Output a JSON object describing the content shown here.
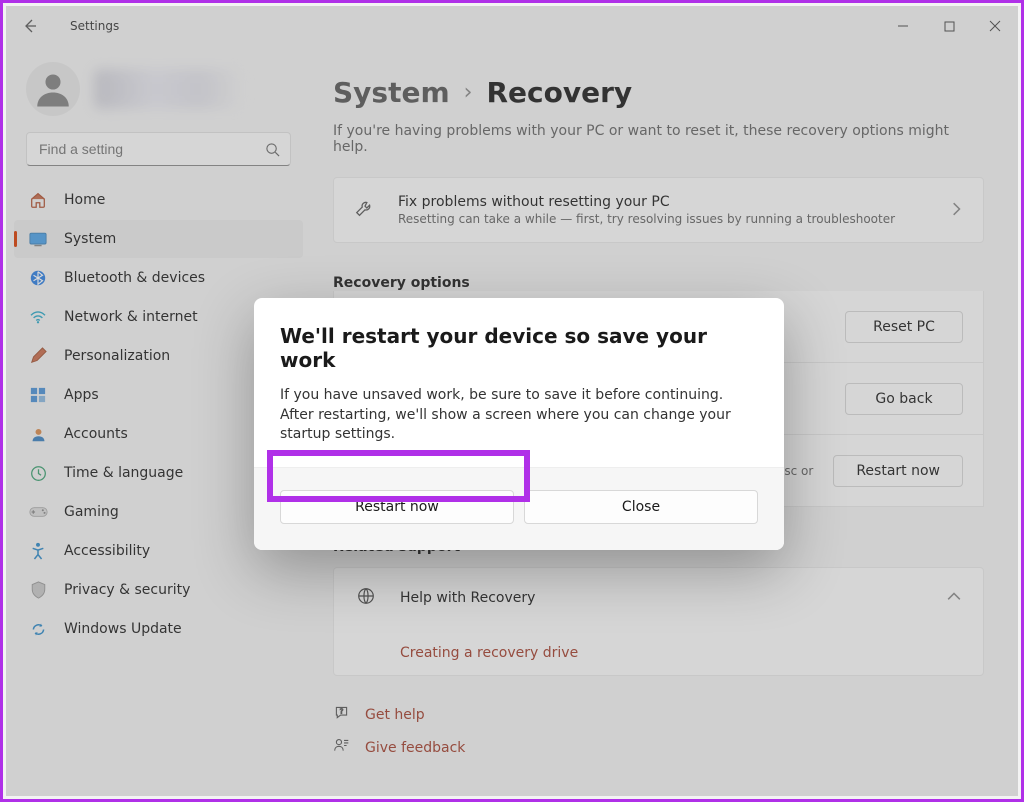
{
  "window": {
    "title": "Settings"
  },
  "search": {
    "placeholder": "Find a setting"
  },
  "nav": {
    "items": [
      {
        "label": "Home",
        "icon": "home-icon"
      },
      {
        "label": "System",
        "icon": "system-icon"
      },
      {
        "label": "Bluetooth & devices",
        "icon": "bluetooth-icon"
      },
      {
        "label": "Network & internet",
        "icon": "network-icon"
      },
      {
        "label": "Personalization",
        "icon": "personalization-icon"
      },
      {
        "label": "Apps",
        "icon": "apps-icon"
      },
      {
        "label": "Accounts",
        "icon": "accounts-icon"
      },
      {
        "label": "Time & language",
        "icon": "time-language-icon"
      },
      {
        "label": "Gaming",
        "icon": "gaming-icon"
      },
      {
        "label": "Accessibility",
        "icon": "accessibility-icon"
      },
      {
        "label": "Privacy & security",
        "icon": "privacy-icon"
      },
      {
        "label": "Windows Update",
        "icon": "update-icon"
      }
    ],
    "active_index": 1
  },
  "breadcrumb": {
    "parent": "System",
    "current": "Recovery"
  },
  "intro": "If you're having problems with your PC or want to reset it, these recovery options might help.",
  "fix_card": {
    "title": "Fix problems without resetting your PC",
    "subtitle": "Resetting can take a while — first, try resolving issues by running a troubleshooter"
  },
  "recovery": {
    "section_title": "Recovery options",
    "rows": [
      {
        "trailing_text": "",
        "button": "Reset PC"
      },
      {
        "trailing_text": "",
        "button": "Go back"
      },
      {
        "trailing_text": "disc or",
        "button": "Restart now"
      }
    ]
  },
  "related": {
    "section_title": "Related support",
    "help_title": "Help with Recovery",
    "link": "Creating a recovery drive"
  },
  "bottom": {
    "get_help": "Get help",
    "give_feedback": "Give feedback"
  },
  "modal": {
    "title": "We'll restart your device so save your work",
    "text": "If you have unsaved work, be sure to save it before continuing. After restarting, we'll show a screen where you can change your startup settings.",
    "primary": "Restart now",
    "secondary": "Close"
  }
}
